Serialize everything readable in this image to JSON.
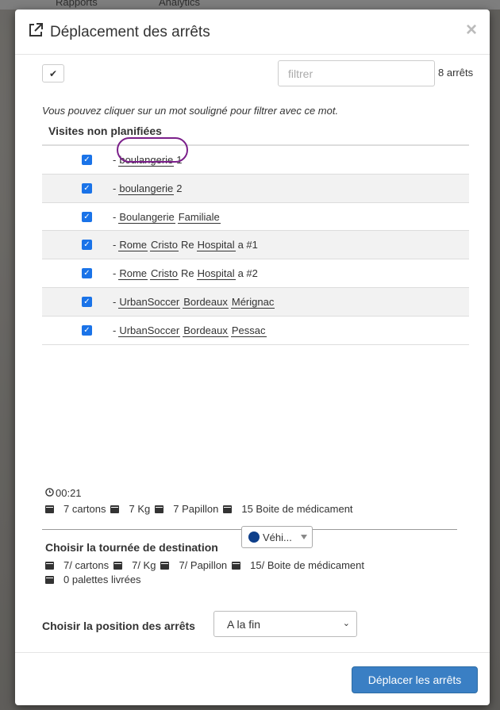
{
  "background": {
    "nav": [
      "Rapports",
      "Analytics"
    ]
  },
  "modal": {
    "title": "Déplacement des arrêts",
    "close_label": "×",
    "filter_placeholder": "filtrer",
    "count": "8 arrêts",
    "hint": "Vous pouvez cliquer sur un mot souligné pour filtrer avec ce mot.",
    "section_title": "Visites non planifiées",
    "rows": [
      {
        "words": [
          "boulangerie"
        ],
        "plain_after": "1"
      },
      {
        "words": [
          "boulangerie"
        ],
        "plain_after": "2"
      },
      {
        "words": [
          "Boulangerie",
          "Familiale"
        ],
        "plain_after": ""
      },
      {
        "words": [
          "Rome",
          "Cristo"
        ],
        "mid_plain": "Re",
        "words2": [
          "Hospital"
        ],
        "plain_after": "a #1"
      },
      {
        "words": [
          "Rome",
          "Cristo"
        ],
        "mid_plain": "Re",
        "words2": [
          "Hospital"
        ],
        "plain_after": "a #2"
      },
      {
        "words": [
          "UrbanSoccer",
          "Bordeaux",
          "Mérignac"
        ],
        "plain_after": ""
      },
      {
        "words": [
          "UrbanSoccer",
          "Bordeaux",
          "Pessac"
        ],
        "plain_after": ""
      }
    ],
    "time": "00:21",
    "summary": [
      "7 cartons",
      "7 Kg",
      "7 Papillon",
      "15 Boite de médicament"
    ],
    "dest_label": "Choisir la tournée de destination",
    "vehicle": "Véhi...",
    "vehicle_color": "#0e3f8a",
    "summary2": [
      "7/ cartons",
      "7/ Kg",
      "7/ Papillon",
      "15/ Boite de médicament"
    ],
    "pallets": "0 palettes livrées",
    "position_label": "Choisir la position des arrêts",
    "position_value": "A la fin",
    "move_button": "Déplacer les arrêts"
  }
}
